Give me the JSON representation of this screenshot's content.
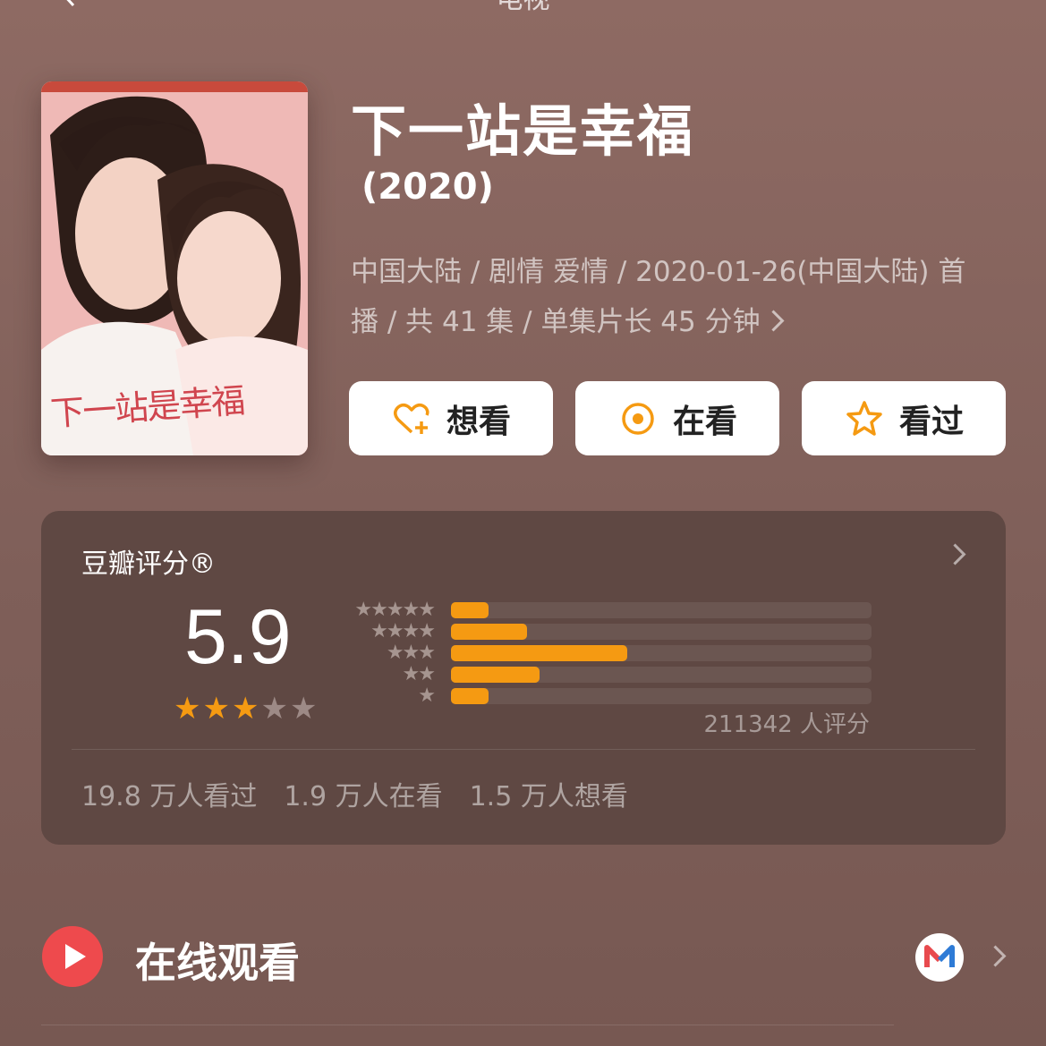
{
  "nav": {
    "title": "电视",
    "back_icon": "chevron-left-icon"
  },
  "show": {
    "title": "下一站是幸福",
    "year": "(2020)",
    "meta_line1": "中国大陆 / 剧情 爱情 / 2020-01-26(中国大陆) 首",
    "meta_line2": "播 / 共 41 集 / 单集片长 45 分钟",
    "poster_caption": "下一站是幸福"
  },
  "actions": [
    {
      "label": "想看",
      "icon": "heart-plus-icon"
    },
    {
      "label": "在看",
      "icon": "target-circle-icon"
    },
    {
      "label": "看过",
      "icon": "star-outline-icon"
    }
  ],
  "rating": {
    "header": "豆瓣评分®",
    "score": "5.9",
    "stars_filled": 3,
    "stars_total": 5,
    "count_text": "211342 人评分",
    "distribution": [
      {
        "stars": "★★★★★",
        "value": 0.09
      },
      {
        "stars": "★★★★",
        "value": 0.18
      },
      {
        "stars": "★★★",
        "value": 0.42
      },
      {
        "stars": "★★",
        "value": 0.21
      },
      {
        "stars": "★",
        "value": 0.09
      }
    ],
    "stats": [
      "19.8 万人看过",
      "1.9 万人在看",
      "1.5 万人想看"
    ],
    "colors": {
      "bar": "#f59a12",
      "star_filled": "#f59a12",
      "star_empty": "#9d8a86"
    }
  },
  "watch": {
    "label": "在线观看",
    "icon": "play-circle-icon",
    "provider_icon": "mgtv-logo-icon"
  }
}
